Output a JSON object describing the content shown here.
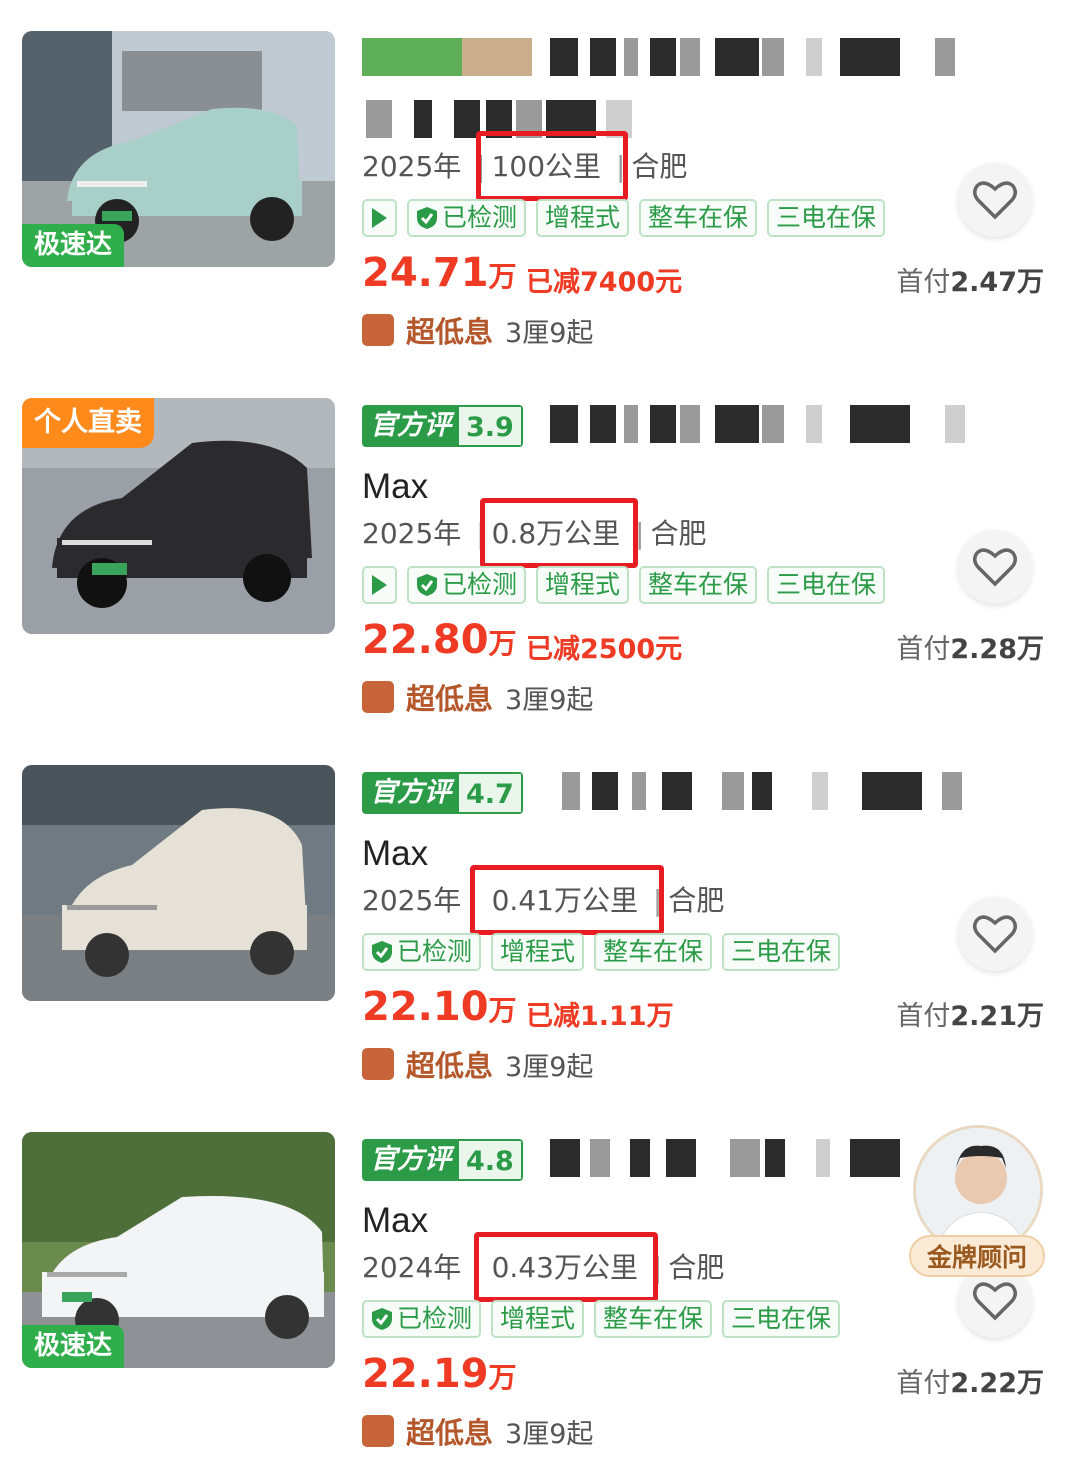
{
  "listings": [
    {
      "image_badge": "极速达",
      "official_rating": null,
      "model": "",
      "year": "2025年",
      "mileage": "100公里",
      "city": "合肥",
      "has_video": true,
      "tags": [
        "已检测",
        "增程式",
        "整车在保",
        "三电在保"
      ],
      "price": "24.71",
      "price_unit": "万",
      "reduction": "已减7400元",
      "down_payment_label": "首付",
      "down_payment": "2.47万",
      "loan_label": "超低息",
      "loan_rate": "3厘9起",
      "car_color": "#a9cfc9"
    },
    {
      "image_badge": "个人直卖",
      "official_rating": {
        "label": "官方评",
        "score": "3.9"
      },
      "model": "Max",
      "year": "2025年",
      "mileage": "0.8万公里",
      "city": "合肥",
      "has_video": true,
      "tags": [
        "已检测",
        "增程式",
        "整车在保",
        "三电在保"
      ],
      "price": "22.80",
      "price_unit": "万",
      "reduction": "已减2500元",
      "down_payment_label": "首付",
      "down_payment": "2.28万",
      "loan_label": "超低息",
      "loan_rate": "3厘9起",
      "car_color": "#2b2b2e"
    },
    {
      "image_badge": "",
      "official_rating": {
        "label": "官方评",
        "score": "4.7"
      },
      "model": "Max",
      "year": "2025年",
      "mileage": "0.41万公里",
      "city": "合肥",
      "has_video": false,
      "tags": [
        "已检测",
        "增程式",
        "整车在保",
        "三电在保"
      ],
      "price": "22.10",
      "price_unit": "万",
      "reduction": "已减1.11万",
      "down_payment_label": "首付",
      "down_payment": "2.21万",
      "loan_label": "超低息",
      "loan_rate": "3厘9起",
      "car_color": "#e6e1d6"
    },
    {
      "image_badge": "极速达",
      "official_rating": {
        "label": "官方评",
        "score": "4.8"
      },
      "model": "Max",
      "year": "2024年",
      "mileage": "0.43万公里",
      "city": "合肥",
      "has_video": false,
      "tags": [
        "已检测",
        "增程式",
        "整车在保",
        "三电在保"
      ],
      "price": "22.19",
      "price_unit": "万",
      "reduction": "",
      "down_payment_label": "首付",
      "down_payment": "2.22万",
      "loan_label": "超低息",
      "loan_rate": "3厘9起",
      "car_color": "#f3f4f6"
    }
  ],
  "advisor": {
    "label": "金牌顾问"
  },
  "colors": {
    "price_red": "#ef3a24",
    "brand_green": "#2b9b47",
    "highlight_red": "#e81c23",
    "fast_badge": "#2fae4b",
    "personal_badge": "#ff8a1c"
  }
}
